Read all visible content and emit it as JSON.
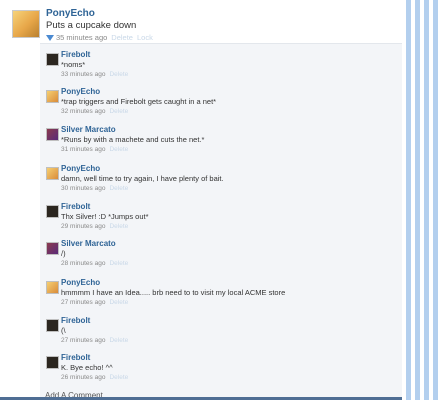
{
  "post": {
    "author": "PonyEcho",
    "text": "Puts a cupcake down",
    "time": "35 minutes ago",
    "delete": "Delete",
    "lock": "Lock"
  },
  "comments": [
    {
      "author": "Firebolt",
      "text": "*noms*",
      "time": "33 minutes ago",
      "delete": "Delete",
      "avatar": "firebolt-avatar"
    },
    {
      "author": "PonyEcho",
      "text": "*trap triggers and Firebolt gets caught in a net*",
      "time": "32 minutes ago",
      "delete": "Delete",
      "avatar": "ponyecho-avatar"
    },
    {
      "author": "Silver Marcato",
      "text": "*Runs by with a machete and cuts the net.*",
      "time": "31 minutes ago",
      "delete": "Delete",
      "avatar": "silver-avatar"
    },
    {
      "author": "PonyEcho",
      "text": "damn, well time to try again, I have plenty of bait.",
      "time": "30 minutes ago",
      "delete": "Delete",
      "avatar": "ponyecho-avatar"
    },
    {
      "author": "Firebolt",
      "text": "Thx Silver! :D *Jumps out*",
      "time": "29 minutes ago",
      "delete": "Delete",
      "avatar": "firebolt-avatar"
    },
    {
      "author": "Silver Marcato",
      "text": "/)",
      "time": "28 minutes ago",
      "delete": "Delete",
      "avatar": "silver-avatar"
    },
    {
      "author": "PonyEcho",
      "text": "hmmmm I have an Idea..... brb need to to visit my local ACME store",
      "time": "27 minutes ago",
      "delete": "Delete",
      "avatar": "ponyecho-avatar"
    },
    {
      "author": "Firebolt",
      "text": "(\\",
      "time": "27 minutes ago",
      "delete": "Delete",
      "avatar": "firebolt-avatar"
    },
    {
      "author": "Firebolt",
      "text": "K. Bye echo! ^^",
      "time": "26 minutes ago",
      "delete": "Delete",
      "avatar": "firebolt-avatar"
    }
  ],
  "add_comment": "Add A Comment"
}
